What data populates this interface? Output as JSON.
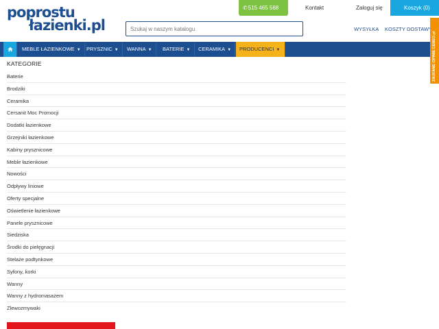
{
  "logo": {
    "line1": "poprostu",
    "line2": "łazienki.pl"
  },
  "search": {
    "placeholder": "Szukaj w naszym katalogu"
  },
  "top": {
    "phone": "515 465 568",
    "contact": "Kontakt",
    "login": "Zaloguj się",
    "cart": "Koszyk (0)",
    "shipping": "WYSYŁKA",
    "shipping_costs": "KOSZTY DOSTAWY"
  },
  "badge": {
    "text": "ZAUFANE OPINIE CENEO.pl"
  },
  "nav": {
    "home_icon": "home-icon",
    "items": [
      "MEBLE ŁAZIENKOWE",
      "PRYSZNIC",
      "WANNA",
      "BATERIE",
      "CERAMIKA",
      "PRODUCENCI"
    ]
  },
  "categories": {
    "title": "KATEGORIE",
    "items": [
      "Baterie",
      "Brodziki",
      "Ceramika",
      "Cersanit Moc Promocji",
      "Dodatki łazienkowe",
      "Grzejniki łazienkowe",
      "Kabiny prysznicowe",
      "Meble łazienkowe",
      "Nowości",
      "Odpływy liniowe",
      "Oferty specjalne",
      "Oświetlenie łazienkowe",
      "Panele prysznicowe",
      "Siedziska",
      "Środki do pielęgnacji",
      "Stelaże podtynkowe",
      "Syfony, korki",
      "Wanny",
      "Wanny z hydromasażem",
      "Zlewozmywaki"
    ]
  },
  "colors": {
    "brand_blue": "#1d4e8f",
    "accent_blue": "#19a7e0",
    "green": "#7ec242",
    "orange": "#f39200",
    "producers_yellow": "#f6b21a",
    "promo_red": "#e3161d"
  }
}
